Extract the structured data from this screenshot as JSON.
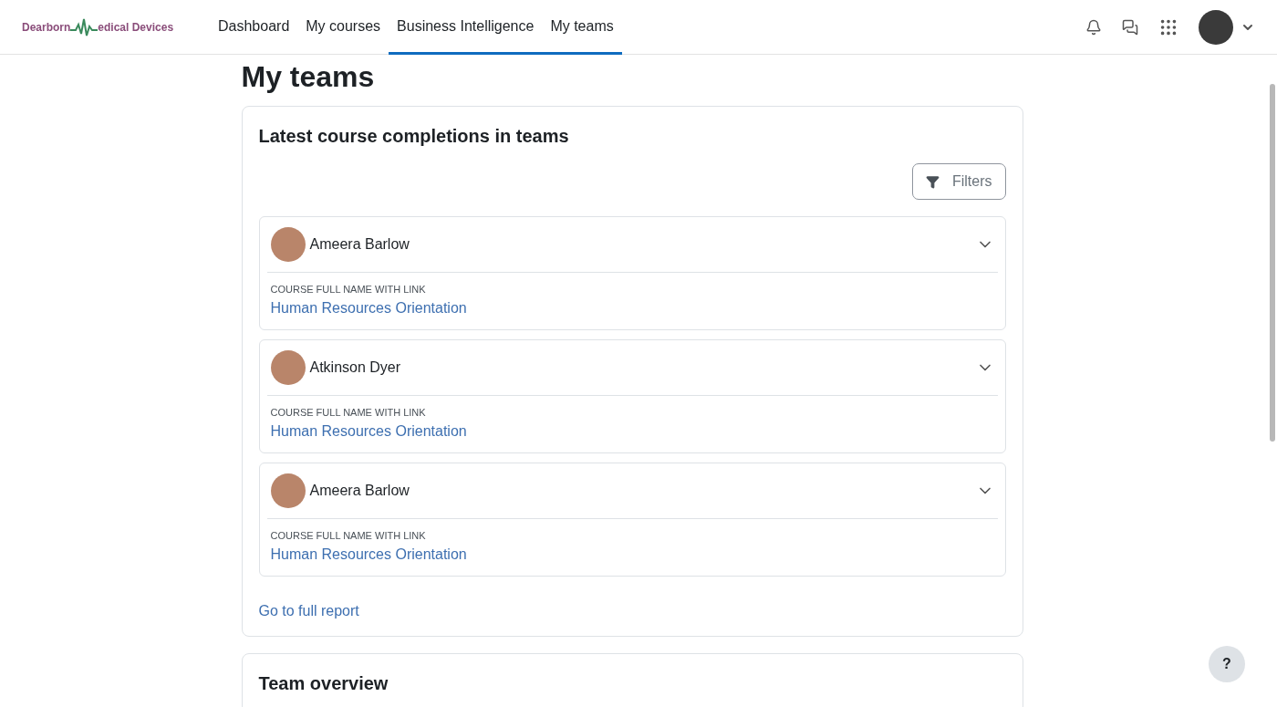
{
  "logo": {
    "before": "Dearborn",
    "after": "edical Devices"
  },
  "nav": [
    {
      "label": "Dashboard",
      "selected": false
    },
    {
      "label": "My courses",
      "selected": false
    },
    {
      "label": "Business Intelligence",
      "selected": true
    },
    {
      "label": "My teams",
      "selected": true
    }
  ],
  "page_title": "My teams",
  "completions": {
    "title": "Latest course completions in teams",
    "filters_button": "Filters",
    "items": [
      {
        "name": "Ameera Barlow",
        "expanded": false,
        "field_label": "COURSE FULL NAME WITH LINK",
        "course": "Human Resources Orientation"
      },
      {
        "name": "Atkinson Dyer",
        "expanded": false,
        "field_label": "COURSE FULL NAME WITH LINK",
        "course": "Human Resources Orientation"
      },
      {
        "name": "Ameera Barlow",
        "expanded": false,
        "field_label": "COURSE FULL NAME WITH LINK",
        "course": "Human Resources Orientation"
      }
    ],
    "report_link": "Go to full report"
  },
  "team_overview": {
    "title": "Team overview"
  },
  "help_button": "?"
}
